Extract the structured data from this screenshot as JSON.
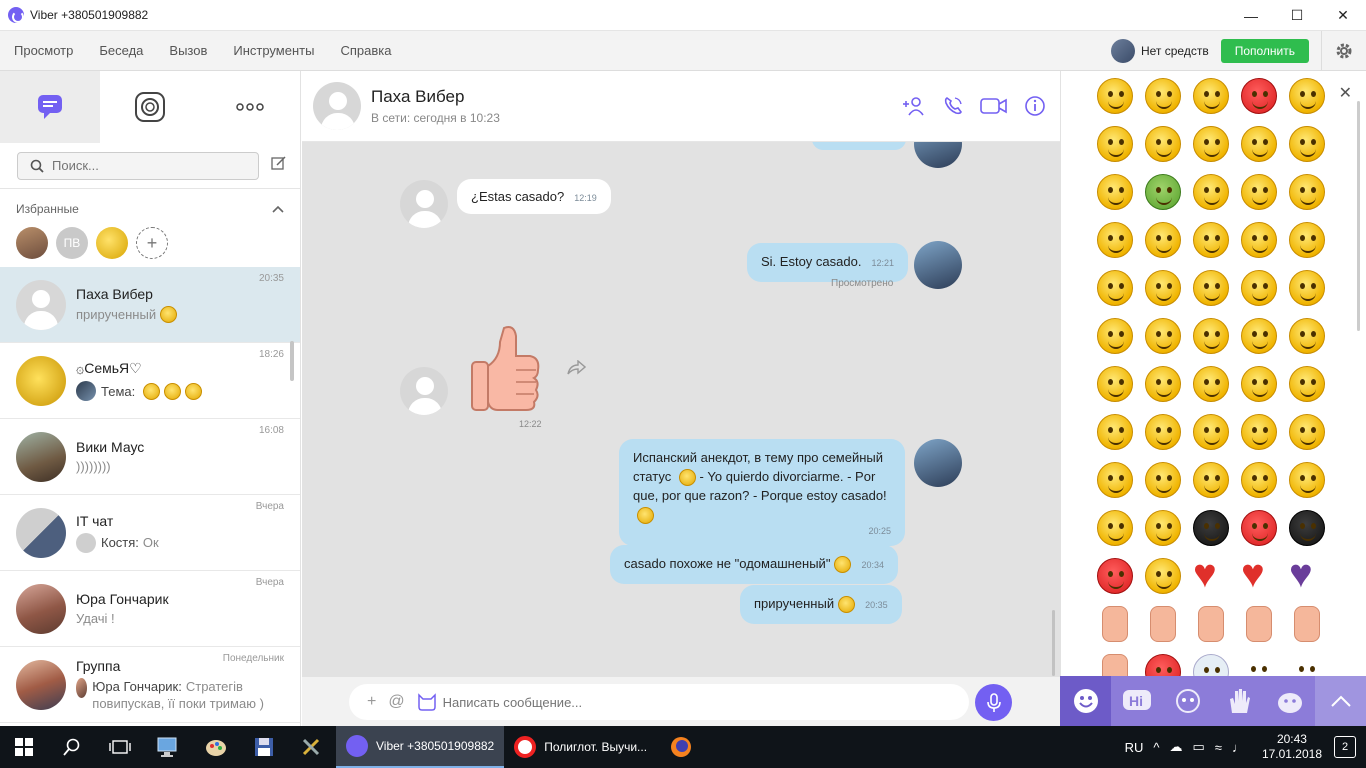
{
  "window": {
    "title": "Viber +380501909882"
  },
  "menu": {
    "items": [
      "Просмотр",
      "Беседа",
      "Вызов",
      "Инструменты",
      "Справка"
    ],
    "balance": "Нет средств",
    "topup": "Пополнить"
  },
  "left": {
    "search_placeholder": "Поиск...",
    "favorites_title": "Избранные",
    "favorites": [
      {
        "label": ""
      },
      {
        "label": "ПВ"
      },
      {
        "label": ""
      },
      {
        "label": "+"
      }
    ],
    "chats": [
      {
        "name": "Паха Вибер",
        "preview": "прирученный",
        "time": "20:35"
      },
      {
        "name": "۞СемьЯ♡",
        "sender": "Тема:",
        "preview": "",
        "time": "18:26"
      },
      {
        "name": "Вики Маус",
        "preview": "))))))))",
        "time": "16:08"
      },
      {
        "name": "IT чат",
        "sender": "Костя:",
        "preview": "Ок",
        "time": "Вчера"
      },
      {
        "name": "Юра Гончарик",
        "preview": "Удачі !",
        "time": "Вчера"
      },
      {
        "name": "Группа",
        "sender": "Юра Гончарик:",
        "preview": "Стратегів повипускав, її поки тримаю )",
        "time": "Понедельник"
      }
    ]
  },
  "chat": {
    "name": "Паха Вибер",
    "status": "В сети: сегодня в 10:23",
    "messages": [
      {
        "text": "¿Estas casado?",
        "time": "12:19"
      },
      {
        "text": "Si. Estoy casado.",
        "time": "12:21",
        "status": "Просмотрено"
      },
      {
        "sticker": "thumbs-up",
        "time": "12:22"
      },
      {
        "text": "Испанский анекдот, в тему про семейный статус",
        "text2": "- Yo quierdo divorciarme.   - Por que, por que razon? - Porque estoy casado!",
        "time": "20:25"
      },
      {
        "text": "casado похоже не \"одомашненый\"",
        "time": "20:34"
      },
      {
        "text": "прирученный",
        "time": "20:35"
      }
    ],
    "composer_placeholder": "Написать сообщение..."
  },
  "taskbar": {
    "apps": [
      {
        "label": "Viber +380501909882"
      },
      {
        "label": "Полиглот. Выучи..."
      }
    ],
    "lang": "RU",
    "time": "20:43",
    "date": "17.01.2018",
    "notifications": "2"
  },
  "colors": {
    "viber": "#7360f2",
    "topup": "#2fbd4e",
    "outgoing": "#b9def2",
    "chat_bg": "#e2e2e2"
  }
}
